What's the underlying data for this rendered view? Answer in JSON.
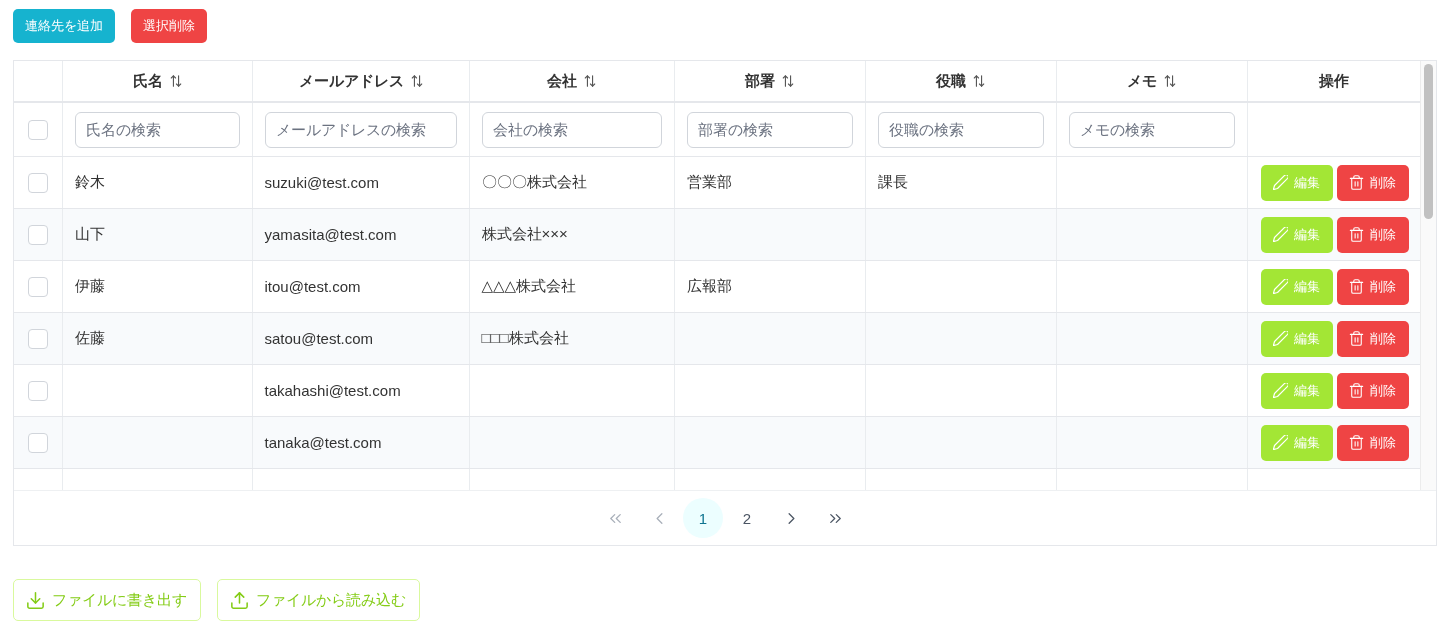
{
  "toolbar": {
    "buttons": [
      {
        "kind": "primary",
        "label": "連絡先を追加"
      },
      {
        "kind": "danger",
        "label": "選択削除"
      }
    ]
  },
  "table": {
    "columns": [
      {
        "label": "氏名",
        "sortable": true,
        "filter": {
          "placeholder": "氏名の検索"
        }
      },
      {
        "label": "メールアドレス",
        "sortable": true,
        "filter": {
          "placeholder": "メールアドレスの検索"
        }
      },
      {
        "label": "会社",
        "sortable": true,
        "filter": {
          "placeholder": "会社の検索"
        }
      },
      {
        "label": "部署",
        "sortable": true,
        "filter": {
          "placeholder": "部署の検索"
        }
      },
      {
        "label": "役職",
        "sortable": true,
        "filter": {
          "placeholder": "役職の検索"
        }
      },
      {
        "label": "メモ",
        "sortable": true,
        "filter": {
          "placeholder": "メモの検索"
        }
      },
      {
        "label": "操作",
        "sortable": false
      }
    ],
    "select_all": {
      "checked": false
    },
    "rows": [
      {
        "checked": false,
        "name": "鈴木",
        "email": "suzuki@test.com",
        "company": "〇〇〇株式会社",
        "department": "営業部",
        "position": "課長",
        "actions": [
          {
            "kind": "edit",
            "label": "編集"
          },
          {
            "kind": "delete",
            "label": "削除"
          }
        ]
      },
      {
        "checked": false,
        "name": "山下",
        "email": "yamasita@test.com",
        "company": "株式会社×××",
        "actions": [
          {
            "kind": "edit",
            "label": "編集"
          },
          {
            "kind": "delete",
            "label": "削除"
          }
        ]
      },
      {
        "checked": false,
        "name": "伊藤",
        "email": "itou@test.com",
        "company": "△△△株式会社",
        "department": "広報部",
        "actions": [
          {
            "kind": "edit",
            "label": "編集"
          },
          {
            "kind": "delete",
            "label": "削除"
          }
        ]
      },
      {
        "checked": false,
        "name": "佐藤",
        "email": "satou@test.com",
        "company": "□□□株式会社",
        "actions": [
          {
            "kind": "edit",
            "label": "編集"
          },
          {
            "kind": "delete",
            "label": "削除"
          }
        ]
      },
      {
        "checked": false,
        "email": "takahashi@test.com",
        "actions": [
          {
            "kind": "edit",
            "label": "編集"
          },
          {
            "kind": "delete",
            "label": "削除"
          }
        ]
      },
      {
        "checked": false,
        "email": "tanaka@test.com",
        "actions": [
          {
            "kind": "edit",
            "label": "編集"
          },
          {
            "kind": "delete",
            "label": "削除"
          }
        ]
      }
    ]
  },
  "pagination": {
    "first": {
      "disabled": true
    },
    "prev": {
      "disabled": true
    },
    "pages": [
      {
        "label": "1",
        "selected": true
      },
      {
        "label": "2",
        "selected": false
      }
    ],
    "next": {
      "disabled": false
    },
    "last": {
      "disabled": false
    }
  },
  "file_buttons": [
    {
      "kind": "export",
      "label": "ファイルに書き出す"
    },
    {
      "kind": "import",
      "label": "ファイルから読み込む"
    }
  ]
}
